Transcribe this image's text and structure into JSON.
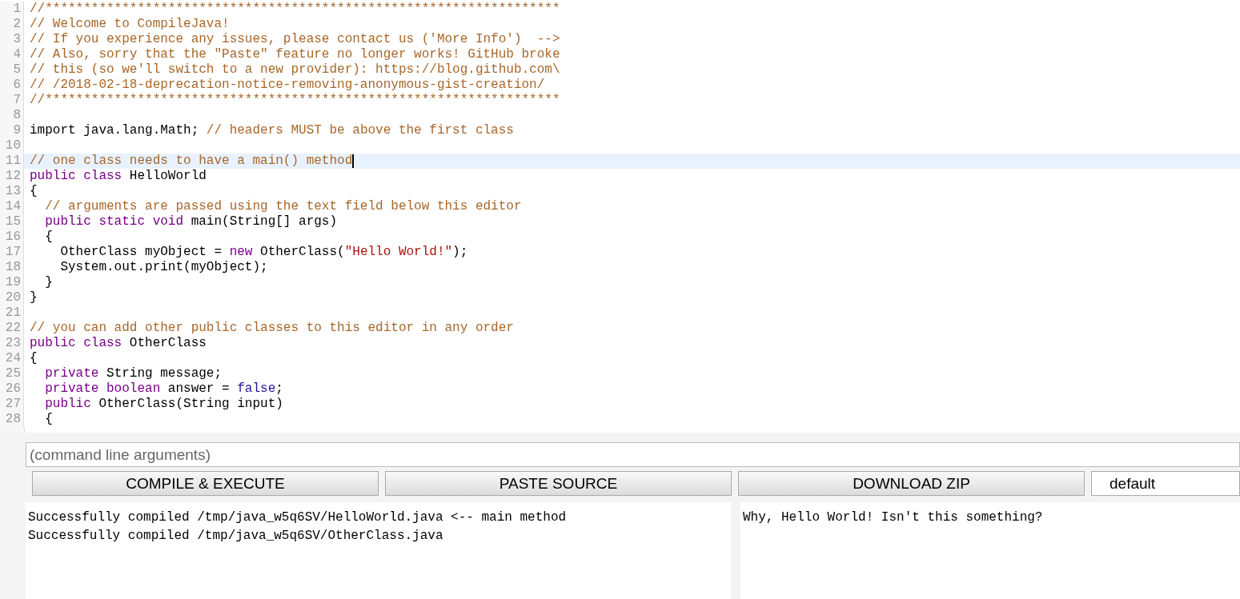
{
  "editor": {
    "lines": [
      {
        "number": "1",
        "active": false,
        "tokens": [
          {
            "kind": "comment",
            "text": "//*******************************************************************"
          }
        ]
      },
      {
        "number": "2",
        "active": false,
        "tokens": [
          {
            "kind": "comment",
            "text": "// Welcome to CompileJava!"
          }
        ]
      },
      {
        "number": "3",
        "active": false,
        "tokens": [
          {
            "kind": "comment",
            "text": "// If you experience any issues, please contact us ('More Info')  -->"
          }
        ]
      },
      {
        "number": "4",
        "active": false,
        "tokens": [
          {
            "kind": "comment",
            "text": "// Also, sorry that the \"Paste\" feature no longer works! GitHub broke"
          }
        ]
      },
      {
        "number": "5",
        "active": false,
        "tokens": [
          {
            "kind": "comment",
            "text": "// this (so we'll switch to a new provider): https://blog.github.com\\"
          }
        ]
      },
      {
        "number": "6",
        "active": false,
        "tokens": [
          {
            "kind": "comment",
            "text": "// /2018-02-18-deprecation-notice-removing-anonymous-gist-creation/"
          }
        ]
      },
      {
        "number": "7",
        "active": false,
        "tokens": [
          {
            "kind": "comment",
            "text": "//*******************************************************************"
          }
        ]
      },
      {
        "number": "8",
        "active": false
      },
      {
        "number": "9",
        "active": false,
        "tokens": [
          {
            "kind": "plain",
            "text": "import java.lang.Math; "
          },
          {
            "kind": "comment",
            "text": "// headers MUST be above the first class"
          }
        ]
      },
      {
        "number": "10",
        "active": false
      },
      {
        "number": "11",
        "active": true,
        "tokens": [
          {
            "kind": "comment",
            "text": "// one class needs to have a main() method"
          }
        ]
      },
      {
        "number": "12",
        "active": false,
        "tokens": [
          {
            "kind": "keyword",
            "text": "public class"
          },
          {
            "kind": "plain",
            "text": " HelloWorld"
          }
        ]
      },
      {
        "number": "13",
        "active": false,
        "tokens": [
          {
            "kind": "plain",
            "text": "{"
          }
        ]
      },
      {
        "number": "14",
        "active": false,
        "tokens": [
          {
            "kind": "comment",
            "text": "  // arguments are passed using the text field below this editor"
          }
        ]
      },
      {
        "number": "15",
        "active": false,
        "tokens": [
          {
            "kind": "keyword",
            "text": "  public static void"
          },
          {
            "kind": "plain",
            "text": " main(String[] args)"
          }
        ]
      },
      {
        "number": "16",
        "active": false,
        "tokens": [
          {
            "kind": "plain",
            "text": "  {"
          }
        ]
      },
      {
        "number": "17",
        "active": false,
        "tokens": [
          {
            "kind": "plain",
            "text": "    OtherClass myObject = "
          },
          {
            "kind": "keyword",
            "text": "new"
          },
          {
            "kind": "plain",
            "text": " OtherClass("
          },
          {
            "kind": "string",
            "text": "\"Hello World!\""
          },
          {
            "kind": "plain",
            "text": ");"
          }
        ]
      },
      {
        "number": "18",
        "active": false,
        "tokens": [
          {
            "kind": "plain",
            "text": "    System.out.print(myObject);"
          }
        ]
      },
      {
        "number": "19",
        "active": false,
        "tokens": [
          {
            "kind": "plain",
            "text": "  }"
          }
        ]
      },
      {
        "number": "20",
        "active": false,
        "tokens": [
          {
            "kind": "plain",
            "text": "}"
          }
        ]
      },
      {
        "number": "21",
        "active": false
      },
      {
        "number": "22",
        "active": false,
        "tokens": [
          {
            "kind": "comment",
            "text": "// you can add other public classes to this editor in any order"
          }
        ]
      },
      {
        "number": "23",
        "active": false,
        "tokens": [
          {
            "kind": "keyword",
            "text": "public class"
          },
          {
            "kind": "plain",
            "text": " OtherClass"
          }
        ]
      },
      {
        "number": "24",
        "active": false,
        "tokens": [
          {
            "kind": "plain",
            "text": "{"
          }
        ]
      },
      {
        "number": "25",
        "active": false,
        "tokens": [
          {
            "kind": "keyword",
            "text": "  private"
          },
          {
            "kind": "plain",
            "text": " String message;"
          }
        ]
      },
      {
        "number": "26",
        "active": false,
        "tokens": [
          {
            "kind": "keyword",
            "text": "  private boolean"
          },
          {
            "kind": "plain",
            "text": " answer = "
          },
          {
            "kind": "atom",
            "text": "false"
          },
          {
            "kind": "plain",
            "text": ";"
          }
        ]
      },
      {
        "number": "27",
        "active": false,
        "tokens": [
          {
            "kind": "keyword",
            "text": "  public"
          },
          {
            "kind": "plain",
            "text": " OtherClass(String input)"
          }
        ]
      },
      {
        "number": "28",
        "active": false,
        "tokens": [
          {
            "kind": "plain",
            "text": "  {"
          }
        ]
      }
    ]
  },
  "arguments": {
    "placeholder": "(command line arguments)"
  },
  "buttons": [
    {
      "label": "COMPILE & EXECUTE"
    },
    {
      "label": "PASTE SOURCE"
    },
    {
      "label": "DOWNLOAD ZIP"
    }
  ],
  "mode_select": {
    "value": "default"
  },
  "compiler_output": [
    "Successfully compiled /tmp/java_w5q6SV/HelloWorld.java <-- main method",
    "Successfully compiled /tmp/java_w5q6SV/OtherClass.java"
  ],
  "program_output": [
    "Why, Hello World! Isn't this something?"
  ]
}
